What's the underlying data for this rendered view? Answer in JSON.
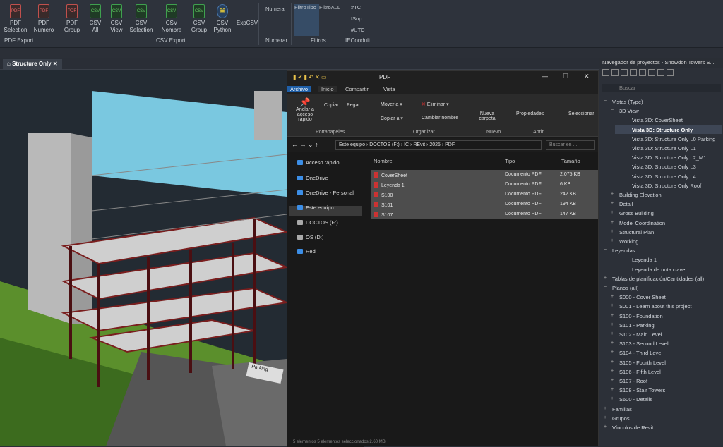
{
  "ribbon": {
    "buttons": [
      {
        "l1": "PDF",
        "l2": "Selection",
        "kind": "pdf"
      },
      {
        "l1": "PDF",
        "l2": "Numero",
        "kind": "pdf"
      },
      {
        "l1": "PDF",
        "l2": "Group",
        "kind": "pdf"
      },
      {
        "l1": "CSV",
        "l2": "All",
        "kind": "csv"
      },
      {
        "l1": "CSV",
        "l2": "View",
        "kind": "csv"
      },
      {
        "l1": "CSV",
        "l2": "Selection",
        "kind": "csv"
      },
      {
        "l1": "CSV",
        "l2": "Nombre",
        "kind": "csv"
      },
      {
        "l1": "CSV",
        "l2": "Group",
        "kind": "csv"
      },
      {
        "l1": "CSV",
        "l2": "Python",
        "kind": "py"
      },
      {
        "l1": "ExpCSV",
        "l2": "",
        "kind": "none"
      }
    ],
    "groups": {
      "pdf": "PDF Export",
      "csv": "CSV Export",
      "numerar": "Numerar",
      "filtros": "Filtros",
      "ieconduit": "IEConduit"
    },
    "numerar_top": "Numerar",
    "filtro_tipo": "FiltroTipo",
    "filtro_all": "FiltroALL",
    "tags": [
      "#TC",
      "ISop",
      "#UTC"
    ]
  },
  "view": {
    "tab_label": "Structure Only",
    "parking_label": "Parking"
  },
  "explorer": {
    "title": "PDF",
    "tabs": [
      "Archivo",
      "Inicio",
      "Compartir",
      "Vista"
    ],
    "ribbon": {
      "anclar": "Anclar a acceso rápido",
      "copiar": "Copiar",
      "pegar": "Pegar",
      "portapapeles": "Portapapeles",
      "mover": "Mover a",
      "copiar_a": "Copiar a",
      "eliminar": "Eliminar",
      "cambiar": "Cambiar nombre",
      "organizar": "Organizar",
      "nueva": "Nueva carpeta",
      "nuevo": "Nuevo",
      "propiedades": "Propiedades",
      "abrir": "Abrir",
      "seleccionar": "Seleccionar"
    },
    "path": [
      "Este equipo",
      "DOCTOS (F:)",
      "IC",
      "REvit",
      "2025",
      "PDF"
    ],
    "search_placeholder": "Buscar en ...",
    "nav": [
      "Acceso rápido",
      "OneDrive",
      "OneDrive - Personal",
      "Este equipo",
      "DOCTOS (F:)",
      "OS (D:)",
      "Red"
    ],
    "columns": {
      "name": "Nombre",
      "type": "Tipo",
      "size": "Tamaño"
    },
    "files": [
      {
        "name": "CoverSheet",
        "type": "Documento PDF",
        "size": "2,075 KB"
      },
      {
        "name": "Leyenda 1",
        "type": "Documento PDF",
        "size": "6 KB"
      },
      {
        "name": "S100",
        "type": "Documento PDF",
        "size": "242 KB"
      },
      {
        "name": "S101",
        "type": "Documento PDF",
        "size": "194 KB"
      },
      {
        "name": "S107",
        "type": "Documento PDF",
        "size": "147 KB"
      }
    ],
    "status": "5 elementos   5 elementos seleccionados  2.60 MB"
  },
  "browser": {
    "title": "Navegador de proyectos - Snowdon Towers S...",
    "search": "Buscar",
    "tree": [
      {
        "t": "Vistas (Type)",
        "lvl": 0,
        "exp": "−"
      },
      {
        "t": "3D View",
        "lvl": 1,
        "exp": "−"
      },
      {
        "t": "Vista 3D: CoverSheet",
        "lvl": 2
      },
      {
        "t": "Vista 3D: Structure Only",
        "lvl": 2,
        "bold": true
      },
      {
        "t": "Vista 3D: Structure Only L0 Parking",
        "lvl": 2
      },
      {
        "t": "Vista 3D: Structure Only L1",
        "lvl": 2
      },
      {
        "t": "Vista 3D: Structure Only L2_M1",
        "lvl": 2
      },
      {
        "t": "Vista 3D: Structure Only L3",
        "lvl": 2
      },
      {
        "t": "Vista 3D: Structure Only L4",
        "lvl": 2
      },
      {
        "t": "Vista 3D: Structure Only Roof",
        "lvl": 2
      },
      {
        "t": "Building Elevation",
        "lvl": 1,
        "exp": "+"
      },
      {
        "t": "Detail",
        "lvl": 1,
        "exp": "+"
      },
      {
        "t": "Gross Building",
        "lvl": 1,
        "exp": "+"
      },
      {
        "t": "Model Coordination",
        "lvl": 1,
        "exp": "+"
      },
      {
        "t": "Structural Plan",
        "lvl": 1,
        "exp": "+"
      },
      {
        "t": "Working",
        "lvl": 1,
        "exp": "+"
      },
      {
        "t": "Leyendas",
        "lvl": 0,
        "exp": "−"
      },
      {
        "t": "Leyenda 1",
        "lvl": 2
      },
      {
        "t": "Leyenda de nota clave",
        "lvl": 2
      },
      {
        "t": "Tablas de planificación/Cantidades (all)",
        "lvl": 0,
        "exp": "+"
      },
      {
        "t": "Planos (all)",
        "lvl": 0,
        "exp": "−"
      },
      {
        "t": "S000 - Cover Sheet",
        "lvl": 1,
        "exp": "+"
      },
      {
        "t": "S001 - Learn about this project",
        "lvl": 1,
        "exp": "+"
      },
      {
        "t": "S100 - Foundation",
        "lvl": 1,
        "exp": "+"
      },
      {
        "t": "S101 - Parking",
        "lvl": 1,
        "exp": "+"
      },
      {
        "t": "S102 - Main Level",
        "lvl": 1,
        "exp": "+"
      },
      {
        "t": "S103 - Second Level",
        "lvl": 1,
        "exp": "+"
      },
      {
        "t": "S104 - Third Level",
        "lvl": 1,
        "exp": "+"
      },
      {
        "t": "S105 - Fourth Level",
        "lvl": 1,
        "exp": "+"
      },
      {
        "t": "S106 - Fifth Level",
        "lvl": 1,
        "exp": "+"
      },
      {
        "t": "S107 - Roof",
        "lvl": 1,
        "exp": "+"
      },
      {
        "t": "S108 - Stair Towers",
        "lvl": 1,
        "exp": "+"
      },
      {
        "t": "S600 - Details",
        "lvl": 1,
        "exp": "+"
      },
      {
        "t": "Familias",
        "lvl": 0,
        "exp": "+"
      },
      {
        "t": "Grupos",
        "lvl": 0,
        "exp": "+"
      },
      {
        "t": "Vínculos de Revit",
        "lvl": 0,
        "exp": "+"
      }
    ]
  }
}
